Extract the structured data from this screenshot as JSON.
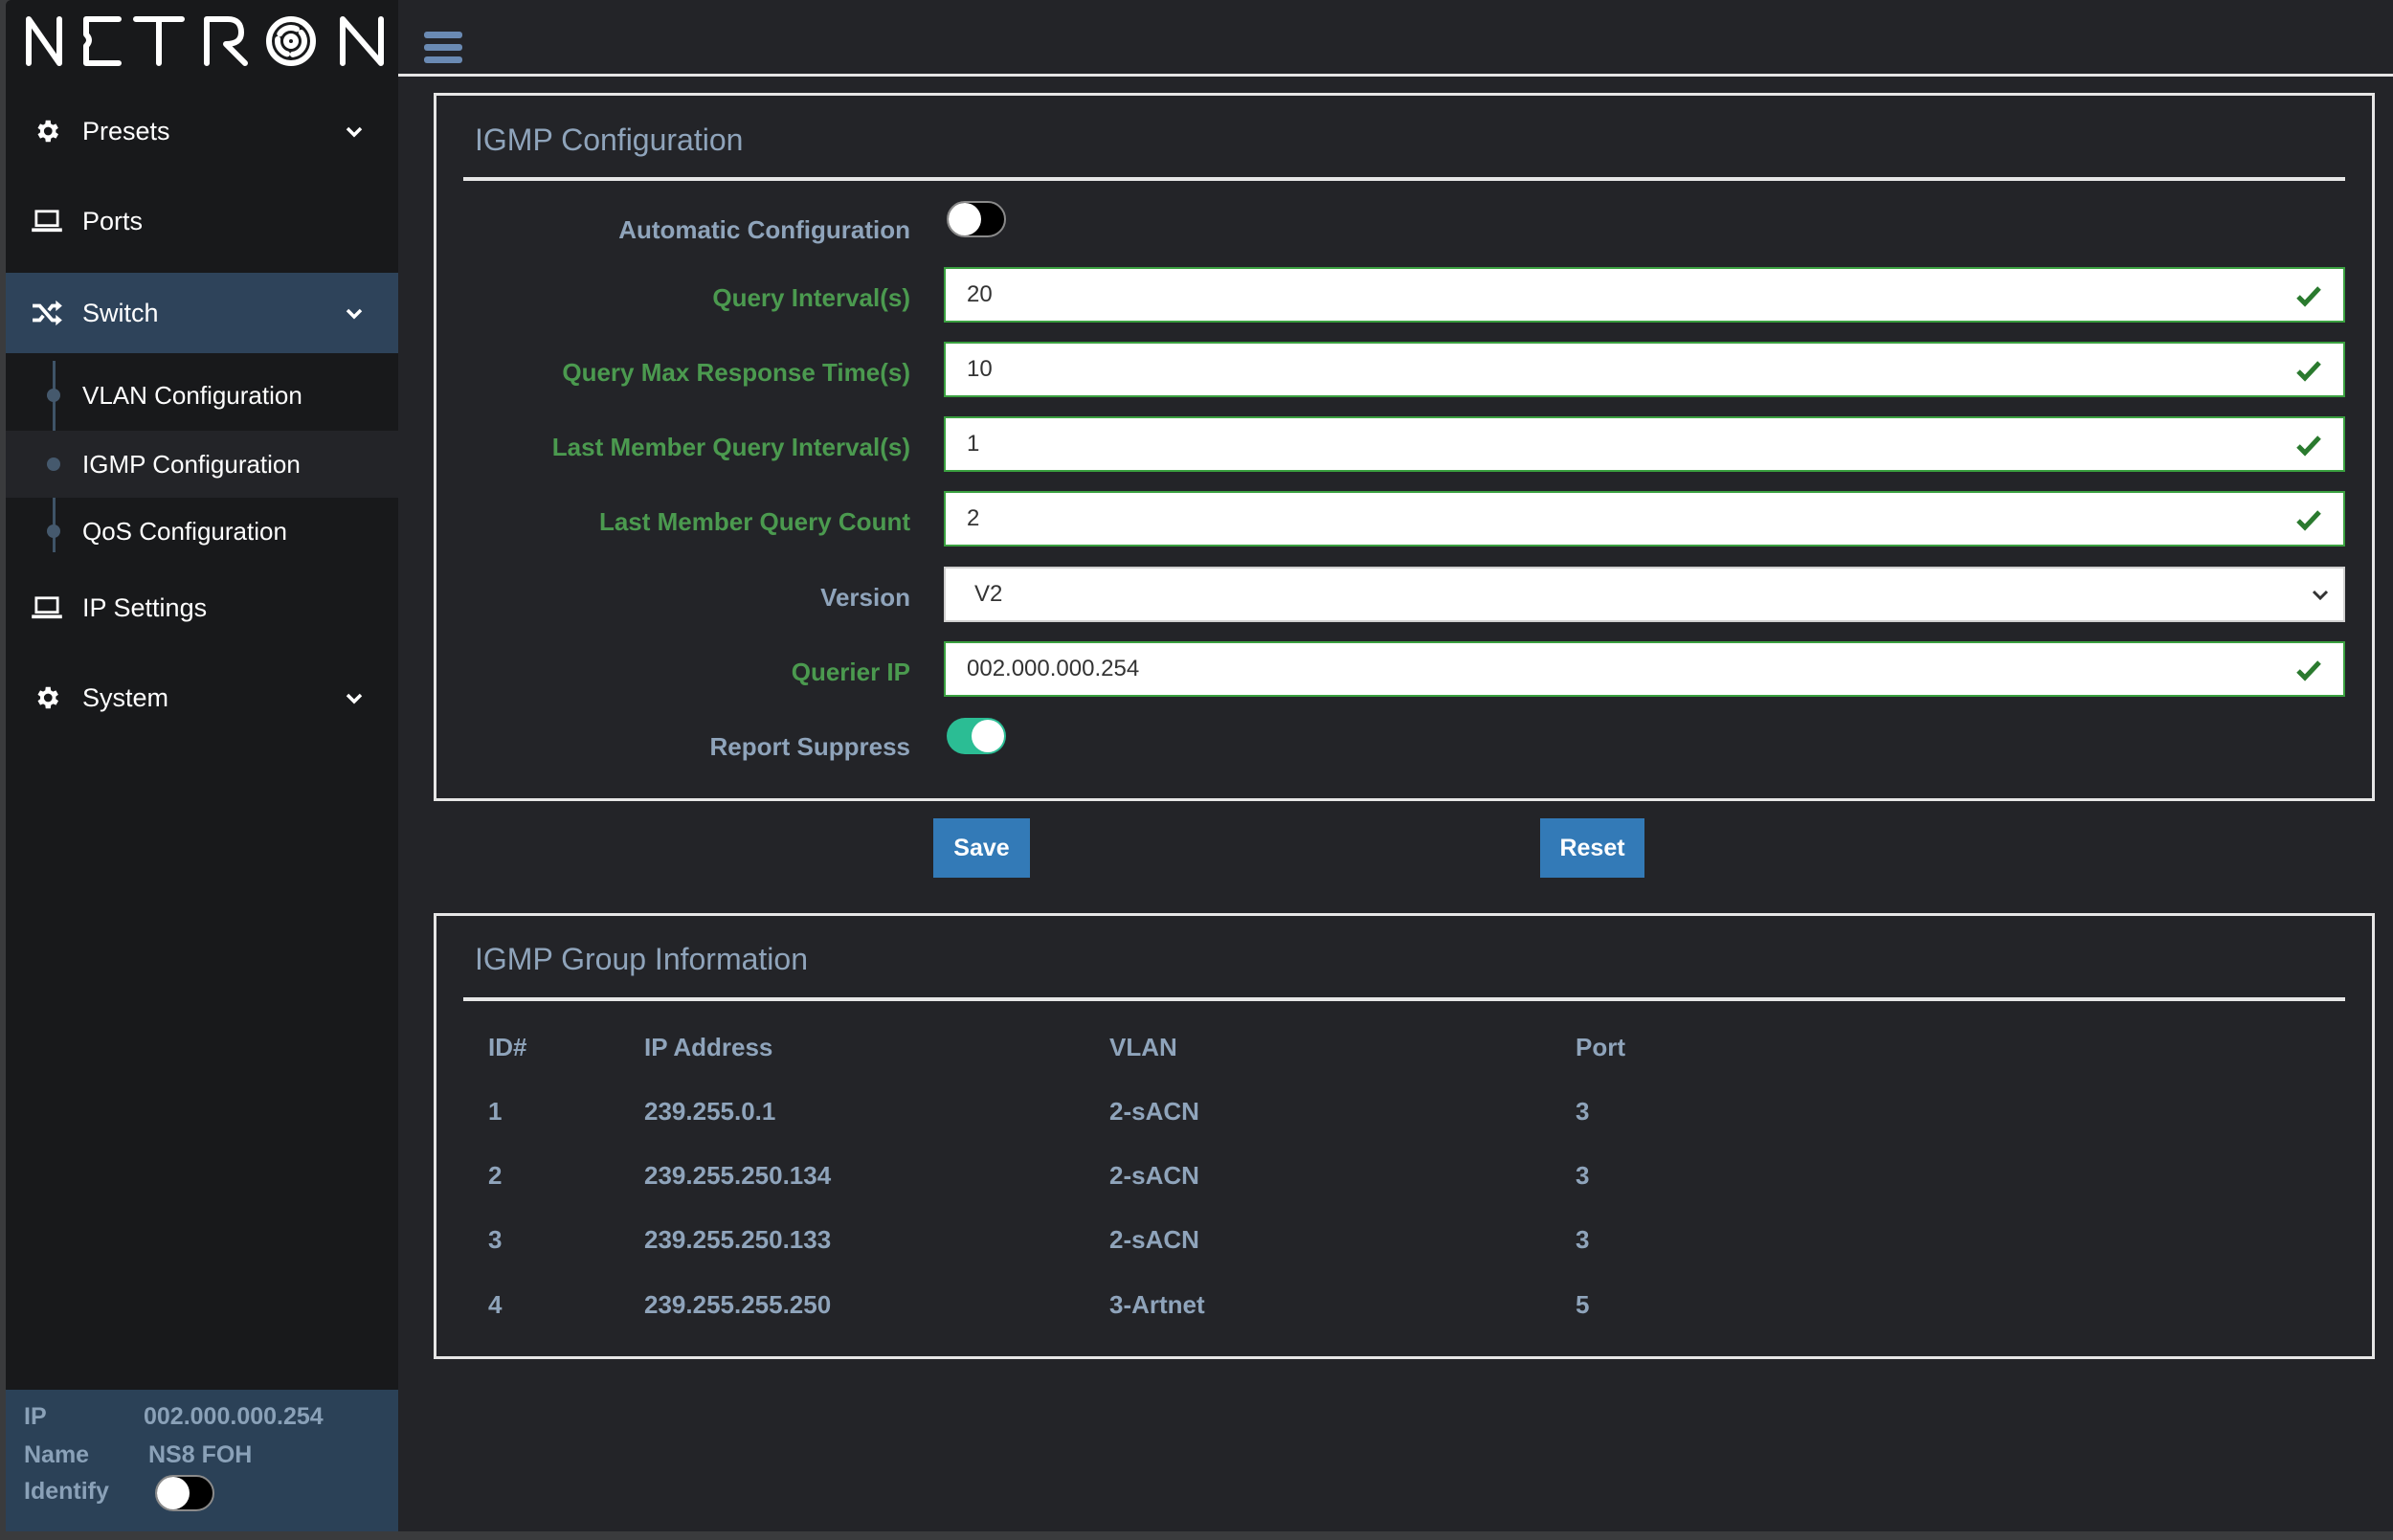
{
  "app": {
    "brand": "NETRON"
  },
  "sidebar": {
    "items": [
      {
        "label": "Presets",
        "icon": "gear-icon",
        "has_chevron": true
      },
      {
        "label": "Ports",
        "icon": "laptop-icon",
        "has_chevron": false
      },
      {
        "label": "Switch",
        "icon": "shuffle-icon",
        "has_chevron": true,
        "active": true
      },
      {
        "label": "IP Settings",
        "icon": "laptop-icon",
        "has_chevron": false
      },
      {
        "label": "System",
        "icon": "gear-icon",
        "has_chevron": true
      }
    ],
    "switch_subitems": [
      {
        "label": "VLAN Configuration"
      },
      {
        "label": "IGMP Configuration",
        "selected": true
      },
      {
        "label": "QoS Configuration"
      }
    ],
    "info": {
      "ip_label": "IP",
      "ip_value": "002.000.000.254",
      "name_label": "Name",
      "name_value": "NS8 FOH",
      "identify_label": "Identify",
      "identify_on": false
    }
  },
  "igmp_config": {
    "title": "IGMP Configuration",
    "automatic_configuration": {
      "label": "Automatic Configuration",
      "on": false
    },
    "fields": {
      "query_interval": {
        "label": "Query Interval(s)",
        "value": "20",
        "valid": true
      },
      "query_max_response_time": {
        "label": "Query Max Response Time(s)",
        "value": "10",
        "valid": true
      },
      "last_member_query_interval": {
        "label": "Last Member Query Interval(s)",
        "value": "1",
        "valid": true
      },
      "last_member_query_count": {
        "label": "Last Member Query Count",
        "value": "2",
        "valid": true
      },
      "version": {
        "label": "Version",
        "value": "V2"
      },
      "querier_ip": {
        "label": "Querier IP",
        "value": "002.000.000.254",
        "valid": true
      }
    },
    "report_suppress": {
      "label": "Report Suppress",
      "on": true
    },
    "buttons": {
      "save": "Save",
      "reset": "Reset"
    }
  },
  "igmp_groups": {
    "title": "IGMP Group Information",
    "columns": [
      "ID#",
      "IP Address",
      "VLAN",
      "Port"
    ],
    "rows": [
      {
        "id": "1",
        "ip": "239.255.0.1",
        "vlan": "2-sACN",
        "port": "3"
      },
      {
        "id": "2",
        "ip": "239.255.250.134",
        "vlan": "2-sACN",
        "port": "3"
      },
      {
        "id": "3",
        "ip": "239.255.250.133",
        "vlan": "2-sACN",
        "port": "3"
      },
      {
        "id": "4",
        "ip": "239.255.255.250",
        "vlan": "3-Artnet",
        "port": "5"
      }
    ]
  },
  "colors": {
    "accent_blue": "#337ab7",
    "active_nav": "#2e435a",
    "valid_green": "#4b9a4f",
    "toggle_on": "#2bbd94",
    "label_blue": "#8fa4bb"
  }
}
